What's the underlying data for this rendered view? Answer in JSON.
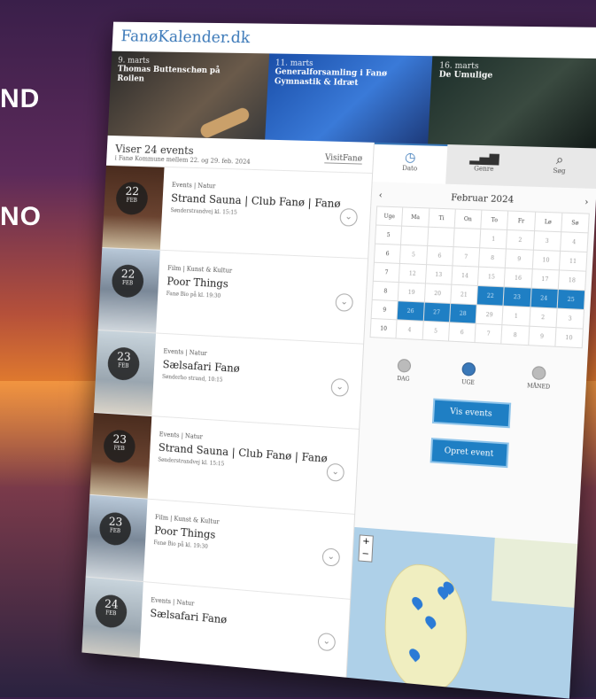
{
  "side_text": [
    "ND",
    "NO"
  ],
  "brand": {
    "logo": "FanøKalender.dk"
  },
  "banner": [
    {
      "date": "9. marts",
      "title": "Thomas Buttenschøn på Roilen"
    },
    {
      "date": "11. marts",
      "title": "Generalforsamling i Fanø Gymnastik & Idræt"
    },
    {
      "date": "16. marts",
      "title": "De Umulige"
    }
  ],
  "list": {
    "count": "Viser 24 events",
    "subtitle": "i Fanø Kommune mellem 22. og 29. feb. 2024",
    "partner_logo": "VisitFanø"
  },
  "events": [
    {
      "day": "22",
      "month": "FEB",
      "category": "Events | Natur",
      "title": "Strand Sauna | Club Fanø | Fanø",
      "meta": "Sønderstrandvej kl. 15:15",
      "thumb": "sauna"
    },
    {
      "day": "22",
      "month": "FEB",
      "category": "Film | Kunst & Kultur",
      "title": "Poor Things",
      "meta": "Fanø Bio på kl. 19:30",
      "thumb": "poor"
    },
    {
      "day": "23",
      "month": "FEB",
      "category": "Events | Natur",
      "title": "Sælsafari Fanø",
      "meta": "Sønderho strand, 10:15",
      "thumb": "sals"
    },
    {
      "day": "23",
      "month": "FEB",
      "category": "Events | Natur",
      "title": "Strand Sauna | Club Fanø | Fanø",
      "meta": "Sønderstrandvej kl. 15:15",
      "thumb": "sauna"
    },
    {
      "day": "23",
      "month": "FEB",
      "category": "Film | Kunst & Kultur",
      "title": "Poor Things",
      "meta": "Fanø Bio på kl. 19:30",
      "thumb": "poor"
    },
    {
      "day": "24",
      "month": "FEB",
      "category": "Events | Natur",
      "title": "Sælsafari Fanø",
      "meta": "",
      "thumb": "sals"
    }
  ],
  "tabs": [
    {
      "label": "Dato",
      "icon": "clock-icon"
    },
    {
      "label": "Genre",
      "icon": "bars-icon"
    },
    {
      "label": "Søg",
      "icon": "search-icon"
    }
  ],
  "calendar": {
    "month": "Februar 2024",
    "weekday_headers": [
      "Uge",
      "Ma",
      "Ti",
      "On",
      "To",
      "Fr",
      "Lø",
      "Sø"
    ],
    "rows": [
      [
        "5",
        "",
        "",
        "",
        "1",
        "2",
        "3",
        "4"
      ],
      [
        "6",
        "5",
        "6",
        "7",
        "8",
        "9",
        "10",
        "11"
      ],
      [
        "7",
        "12",
        "13",
        "14",
        "15",
        "16",
        "17",
        "18"
      ],
      [
        "8",
        "19",
        "20",
        "21",
        "22",
        "23",
        "24",
        "25"
      ],
      [
        "9",
        "26",
        "27",
        "28",
        "29",
        "1",
        "2",
        "3"
      ],
      [
        "10",
        "4",
        "5",
        "6",
        "7",
        "8",
        "9",
        "10"
      ]
    ],
    "selected": [
      "22",
      "23",
      "24",
      "25",
      "26",
      "27",
      "28"
    ]
  },
  "ranges": [
    {
      "label": "DAG",
      "on": false
    },
    {
      "label": "UGE",
      "on": true
    },
    {
      "label": "MÅNED",
      "on": false
    }
  ],
  "buttons": {
    "show_events": "Vis events",
    "create_event": "Opret event"
  },
  "map": {
    "zoom_in": "+",
    "zoom_out": "−"
  }
}
